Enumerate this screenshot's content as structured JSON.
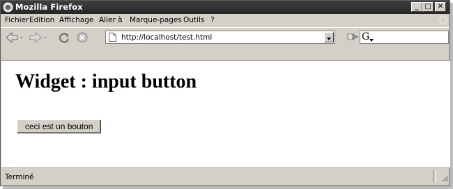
{
  "window": {
    "title": "Mozilla Firefox"
  },
  "titlebar_buttons": {
    "minimize": "_",
    "maximize": "□",
    "close": "✕"
  },
  "menu": [
    {
      "label": "Fichier"
    },
    {
      "label": "Edition"
    },
    {
      "label": "Affichage"
    },
    {
      "label": "Aller à"
    },
    {
      "label": "Marque-pages"
    },
    {
      "label": "Outils"
    },
    {
      "label": "?"
    }
  ],
  "navbar": {
    "url": "http://localhost/test.html",
    "search_engine_glyph": "G"
  },
  "page": {
    "heading": "Widget : input button",
    "button_label": "ceci est un bouton"
  },
  "status": {
    "text": "Terminé"
  },
  "icons": [
    "firefox-icon",
    "throbber-icon",
    "back-icon",
    "forward-icon",
    "reload-icon",
    "stop-icon",
    "page-icon",
    "go-icon",
    "search-engine-icon",
    "resize-grip-icon"
  ]
}
